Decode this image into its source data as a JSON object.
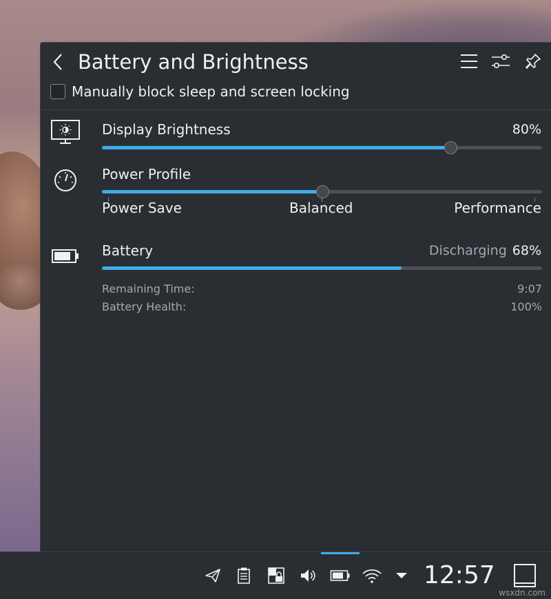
{
  "popup": {
    "title": "Battery and Brightness",
    "block_sleep_label": "Manually block sleep and screen locking",
    "block_sleep_checked": false
  },
  "brightness": {
    "label": "Display Brightness",
    "value_text": "80%",
    "fraction": 0.8
  },
  "power_profile": {
    "label": "Power Profile",
    "options": [
      "Power Save",
      "Balanced",
      "Performance"
    ],
    "selected": "Balanced",
    "selected_index": 1
  },
  "battery": {
    "label": "Battery",
    "status": "Discharging",
    "percent_text": "68%",
    "fraction": 0.68,
    "remaining_label": "Remaining Time:",
    "remaining_value": "9:07",
    "health_label": "Battery Health:",
    "health_value": "100%"
  },
  "taskbar": {
    "clock": "12:57",
    "tray_icons": [
      "send-icon",
      "clipboard-icon",
      "vault-icon",
      "volume-icon",
      "battery-icon",
      "wifi-icon",
      "expand-tray-icon"
    ]
  },
  "watermark": "wsxdn.com",
  "colors": {
    "accent": "#3daee9",
    "panel_bg": "#2a2e32",
    "text": "#eff0f1",
    "muted_text": "#a1a9b1"
  }
}
